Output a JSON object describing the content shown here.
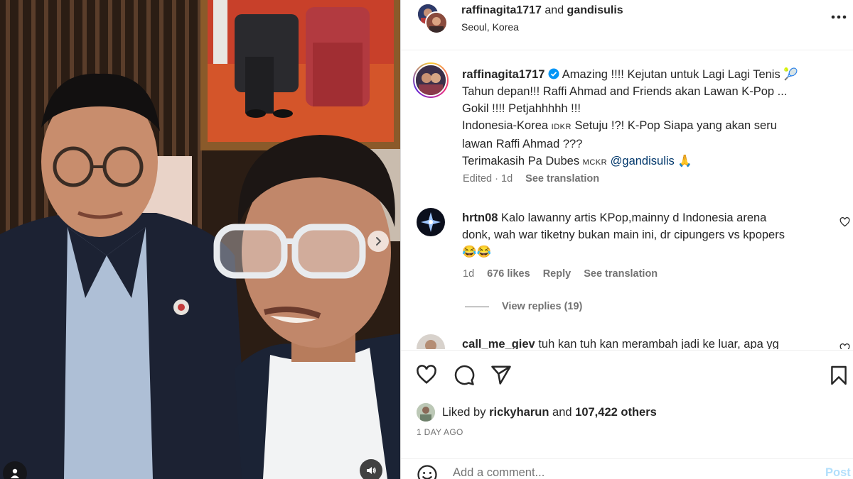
{
  "post": {
    "author": "raffinagita1717",
    "collab_joiner": "and",
    "collaborator": "gandisulis",
    "location": "Seoul, Korea"
  },
  "caption": {
    "username": "raffinagita1717",
    "line1": "Amazing !!!! Kejutan untuk Lagi Lagi Tenis 🎾",
    "line2": "Tahun depan!!! Raffi Ahmad and Friends akan Lawan K-Pop ...",
    "line3": "Gokil !!!! Petjahhhhh !!!",
    "line4a": "Indonesia-Korea ",
    "line4_sc": "IDKR",
    "line4b": " Setuju !?! K-Pop Siapa yang akan seru",
    "line5": "lawan Raffi Ahmad ???",
    "line6a": "Terimakasih Pa Dubes ",
    "line6_sc": "MCKR",
    "line6_mention": "@gandisulis",
    "line6_emoji": "🙏",
    "edited": "Edited · 1d",
    "see_translation": "See translation"
  },
  "comments": [
    {
      "username": "hrtn08",
      "text1": "Kalo lawanny artis KPop,mainny d Indonesia arena",
      "text2": "donk, wah war tiketny bukan main ini, dr cipungers vs kpopers",
      "text3": "😂😂",
      "age": "1d",
      "likes": "676 likes",
      "reply": "Reply",
      "see_translation": "See translation",
      "view_replies": "View replies (19)"
    },
    {
      "username": "call_me_giev",
      "text1": "tuh kan tuh kan merambah jadi ke luar, apa yg"
    }
  ],
  "likes": {
    "prefix": "Liked by",
    "user": "rickyharun",
    "joiner": "and",
    "others": "107,422 others"
  },
  "date": "1 DAY AGO",
  "add_comment": {
    "placeholder": "Add a comment...",
    "post_label": "Post"
  },
  "icons": {
    "more": "more-horizontal-icon",
    "like": "heart-icon",
    "comment": "comment-bubble-icon",
    "share": "paper-plane-icon",
    "save": "bookmark-icon",
    "emoji": "smiley-icon",
    "next": "chevron-right-icon",
    "tag": "user-tag-icon",
    "sound": "speaker-icon",
    "verified": "verified-badge-icon"
  },
  "colors": {
    "text": "#262626",
    "muted": "#737373",
    "link": "#00376b",
    "verified": "#0095f6",
    "post_disabled": "#b2dffc"
  }
}
